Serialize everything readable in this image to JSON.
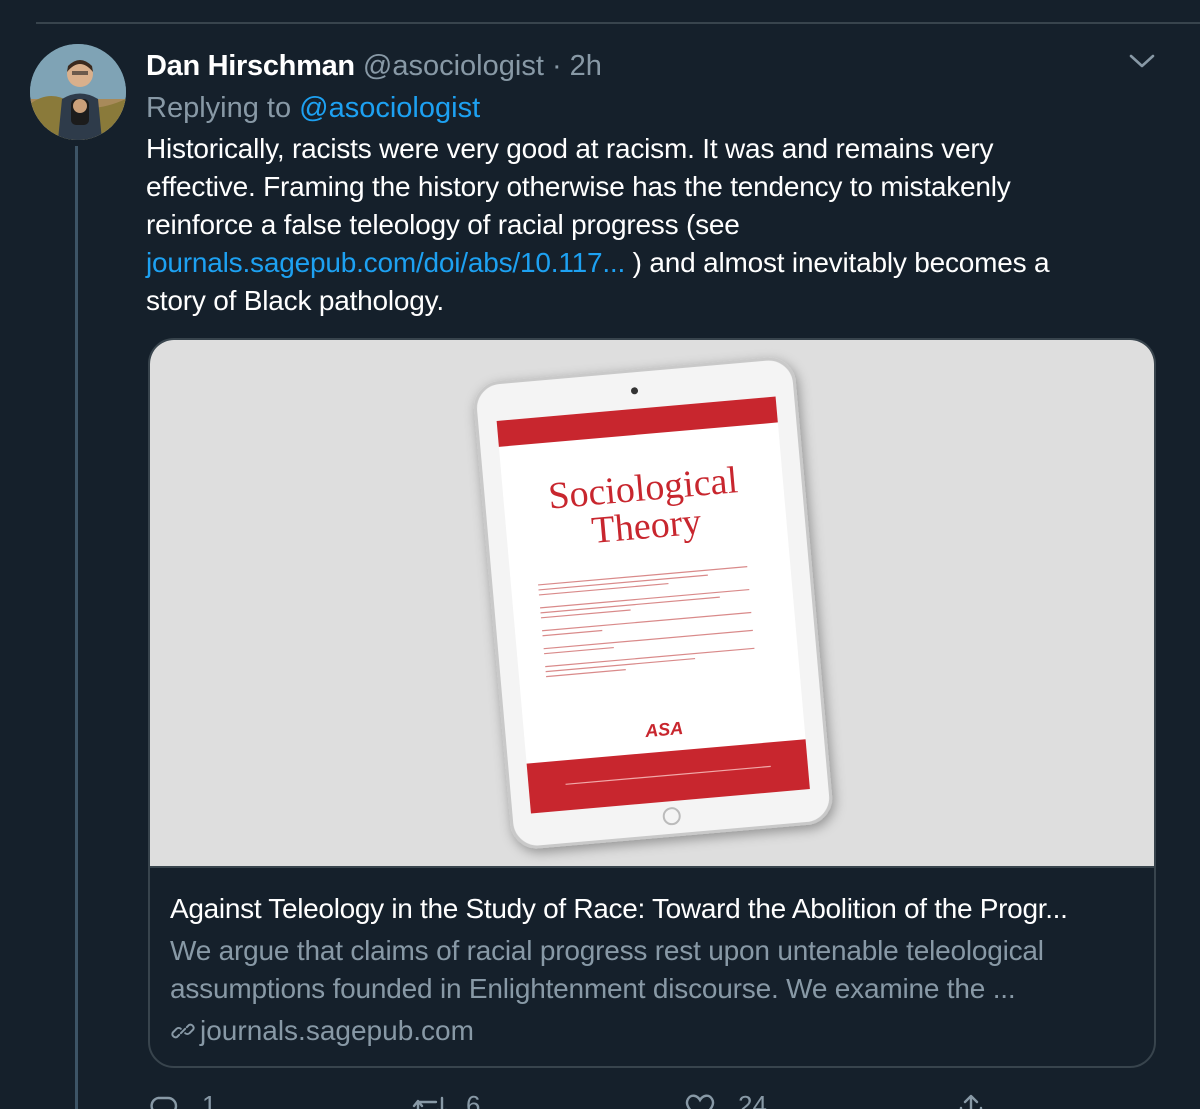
{
  "tweet": {
    "author_name": "Dan Hirschman",
    "author_handle": "@asociologist",
    "separator": "·",
    "time": "2h",
    "replying_prefix": "Replying to",
    "replying_handle": "@asociologist",
    "text_lines": [
      "Historically, racists were very good at racism. It was and remains very",
      "effective. Framing the history otherwise has the tendency to mistakenly",
      "reinforce a false teleology of racial progress (see"
    ],
    "link_text": "journals.sagepub.com/doi/abs/10.117...",
    "after_link": " ) and almost inevitably becomes a",
    "last_line": "story of Black pathology."
  },
  "card": {
    "cover_title_line1": "Sociological",
    "cover_title_line2": "Theory",
    "cover_logo": "ASA",
    "title": "Against Teleology in the Study of Race: Toward the Abolition of the Progr...",
    "description_lines": [
      "We argue that claims of racial progress rest upon untenable teleological",
      "assumptions founded in Enlightenment discourse. We examine the ..."
    ],
    "domain": "journals.sagepub.com"
  },
  "actions": {
    "reply_count": "1",
    "retweet_count": "6",
    "like_count": "24"
  },
  "icons": [
    "chevron-down-icon",
    "link-icon",
    "reply-icon",
    "retweet-icon",
    "like-icon",
    "share-icon"
  ],
  "colors": {
    "background": "#15202b",
    "link": "#1da1f2",
    "muted": "#8899a6",
    "border": "#38444d",
    "cover_red": "#c8262e"
  }
}
